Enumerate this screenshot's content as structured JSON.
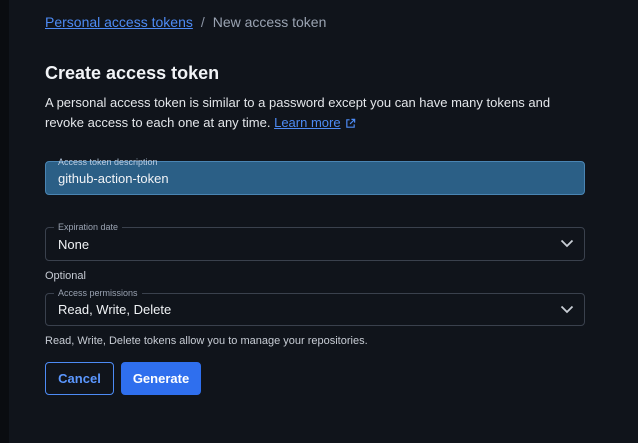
{
  "breadcrumb": {
    "parent_label": "Personal access tokens",
    "separator": "/",
    "current_label": "New access token"
  },
  "page": {
    "title": "Create access token",
    "description": "A personal access token is similar to a password except you can have many tokens and revoke access to each one at any time.",
    "learn_more_label": "Learn more"
  },
  "form": {
    "token_description": {
      "label": "Access token description",
      "value": "github-action-token"
    },
    "expiration": {
      "label": "Expiration date",
      "value": "None",
      "hint": "Optional"
    },
    "permissions": {
      "label": "Access permissions",
      "value": "Read, Write, Delete",
      "hint": "Read, Write, Delete tokens allow you to manage your repositories."
    }
  },
  "actions": {
    "cancel_label": "Cancel",
    "generate_label": "Generate"
  },
  "icons": {
    "external": "external-link-icon",
    "dropdown": "chevron-down-icon"
  },
  "colors": {
    "accent": "#2f6fee",
    "link": "#4d8bf5",
    "background": "#10141b",
    "active_field": "#2b5f86"
  }
}
